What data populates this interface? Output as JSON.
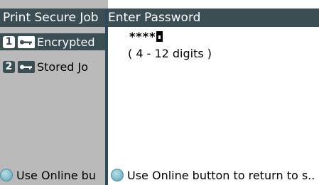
{
  "back_screen": {
    "title": "Print Secure Job",
    "items": [
      {
        "number": "1",
        "icon": "key-icon",
        "label": "Encrypted"
      },
      {
        "number": "2",
        "icon": "key-icon",
        "label": "Stored Jo"
      }
    ],
    "footer": "Use Online bu"
  },
  "front_screen": {
    "title": "Enter Password",
    "password_mask": "****",
    "hint": "( 4 - 12 digits )",
    "footer": "Use Online button to return to s.."
  },
  "colors": {
    "title_bar": "#3a4e54",
    "online_button": "#5aa3b8"
  }
}
